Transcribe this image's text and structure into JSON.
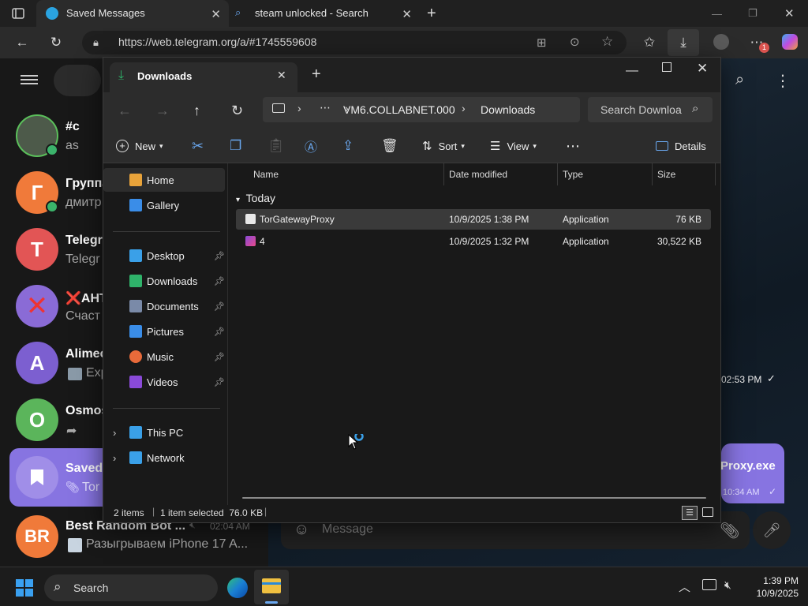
{
  "browser": {
    "tabs": [
      {
        "title": "Saved Messages",
        "active": true
      },
      {
        "title": "steam unlocked - Search",
        "active": false
      }
    ],
    "url": "https://web.telegram.org/a/#1745559608"
  },
  "telegram": {
    "chats": [
      {
        "title": "#c",
        "subtitle": "as",
        "avatar_letter": "",
        "avatar_color": "#4d5a4a"
      },
      {
        "title": "Группа",
        "subtitle": "дмитр",
        "avatar_letter": "Г",
        "avatar_color": "#f07a3a"
      },
      {
        "title": "Telegr",
        "subtitle": "Telegr",
        "avatar_letter": "T",
        "avatar_color": "#e25555"
      },
      {
        "title": "❌АНТ",
        "subtitle": "Счаст",
        "avatar_letter": "✕",
        "avatar_color": "#8a6bd6"
      },
      {
        "title": "Alimec",
        "subtitle": "Exp",
        "avatar_letter": "A",
        "avatar_color": "#7c5fd0"
      },
      {
        "title": "Osmos",
        "subtitle": "",
        "avatar_letter": "O",
        "avatar_color": "#5bb55b"
      },
      {
        "title": "Saved",
        "subtitle": "Tor",
        "avatar_letter": "",
        "avatar_color": "#8774e1"
      },
      {
        "title": "Best Random Bot ...",
        "subtitle": "Разыгрываем iPhone 17 A...",
        "avatar_letter": "BR",
        "avatar_color": "#f07a3a",
        "time": "02:04 AM"
      }
    ],
    "message_time_1": "02:53 PM",
    "bubble_text": "Proxy.exe",
    "bubble_time": "10:34 AM",
    "composer_placeholder": "Message"
  },
  "explorer": {
    "tab_title": "Downloads",
    "breadcrumb": [
      "VM6.COLLABNET.000",
      "Downloads"
    ],
    "search_placeholder": "Search Downloa",
    "commands": {
      "new": "New",
      "sort": "Sort",
      "view": "View",
      "details": "Details"
    },
    "sidebar": {
      "top": [
        {
          "label": "Home",
          "icon": "home-icon",
          "color": "#e8a33a"
        },
        {
          "label": "Gallery",
          "icon": "gallery-icon",
          "color": "#3a8de8"
        }
      ],
      "pinned": [
        {
          "label": "Desktop",
          "icon": "desktop-icon",
          "color": "#3aa0e8"
        },
        {
          "label": "Downloads",
          "icon": "downloads-icon",
          "color": "#2fb36a"
        },
        {
          "label": "Documents",
          "icon": "documents-icon",
          "color": "#7a8aa8"
        },
        {
          "label": "Pictures",
          "icon": "pictures-icon",
          "color": "#3a8de8"
        },
        {
          "label": "Music",
          "icon": "music-icon",
          "color": "#e86a3a"
        },
        {
          "label": "Videos",
          "icon": "videos-icon",
          "color": "#8a4ad8"
        }
      ],
      "bottom": [
        {
          "label": "This PC",
          "icon": "this-pc-icon",
          "color": "#3aa0e8"
        },
        {
          "label": "Network",
          "icon": "network-icon",
          "color": "#3aa0e8"
        }
      ]
    },
    "columns": {
      "name": "Name",
      "date": "Date modified",
      "type": "Type",
      "size": "Size"
    },
    "group": "Today",
    "files": [
      {
        "name": "TorGatewayProxy",
        "date": "10/9/2025 1:38 PM",
        "type": "Application",
        "size": "76 KB",
        "selected": true
      },
      {
        "name": "4",
        "date": "10/9/2025 1:32 PM",
        "type": "Application",
        "size": "30,522 KB",
        "selected": false
      }
    ],
    "status": {
      "count": "2 items",
      "selected": "1 item selected  76.0 KB"
    }
  },
  "taskbar": {
    "search_label": "Search",
    "time": "1:39 PM",
    "date": "10/9/2025"
  }
}
